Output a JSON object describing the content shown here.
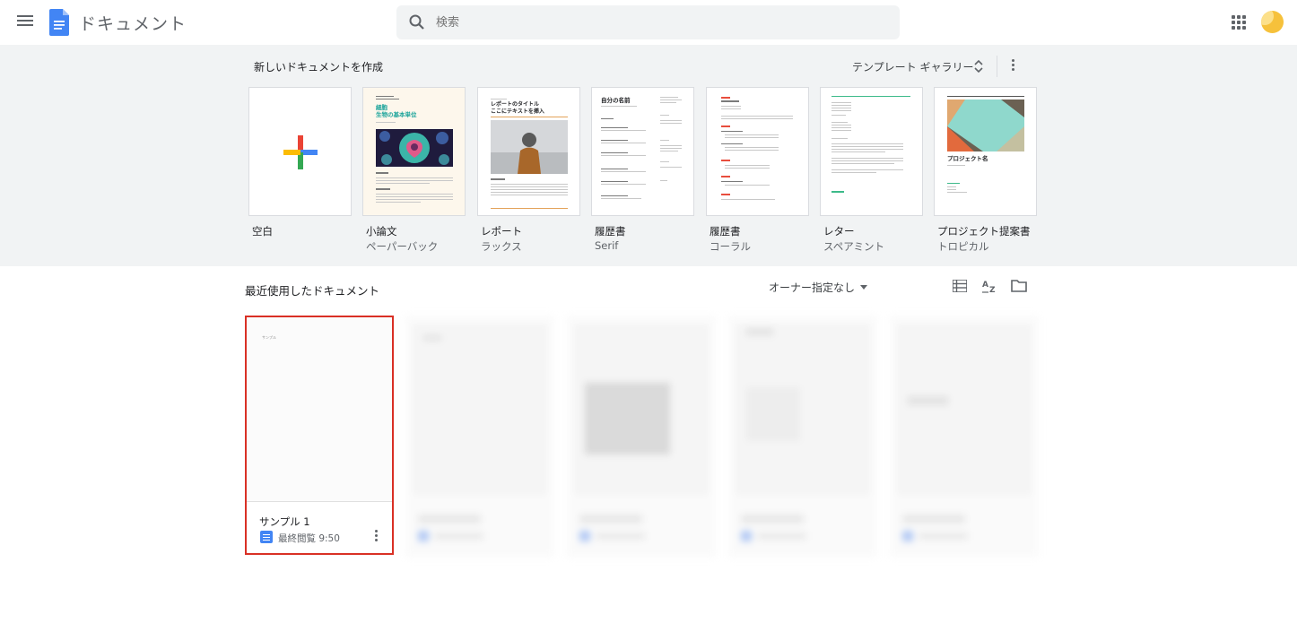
{
  "header": {
    "app_title": "ドキュメント",
    "search_placeholder": "検索"
  },
  "templates": {
    "section_title": "新しいドキュメントを作成",
    "gallery_label": "テンプレート ギャラリー",
    "items": [
      {
        "name": "空白",
        "sub": ""
      },
      {
        "name": "小論文",
        "sub": "ペーパーバック"
      },
      {
        "name": "レポート",
        "sub": "ラックス"
      },
      {
        "name": "履歴書",
        "sub": "Serif"
      },
      {
        "name": "履歴書",
        "sub": "コーラル"
      },
      {
        "name": "レター",
        "sub": "スペアミント"
      },
      {
        "name": "プロジェクト提案書",
        "sub": "トロピカル"
      }
    ],
    "thumb_text": {
      "essay_title": "細胞\n生物の基本単位",
      "report_title": "レポートのタイトル\nここにテキストを挿入",
      "resume_title": "自分の名前",
      "project_title": "プロジェクト名"
    }
  },
  "recent": {
    "title": "最近使用したドキュメント",
    "owner_filter": "オーナー指定なし",
    "docs": [
      {
        "name": "サンプル 1",
        "meta": "最終閲覧 9:50",
        "thumb_text": "サンプル"
      }
    ]
  },
  "colors": {
    "accent_blue": "#4285f4",
    "selection_red": "#d93025",
    "template_bg": "#f1f3f4"
  }
}
